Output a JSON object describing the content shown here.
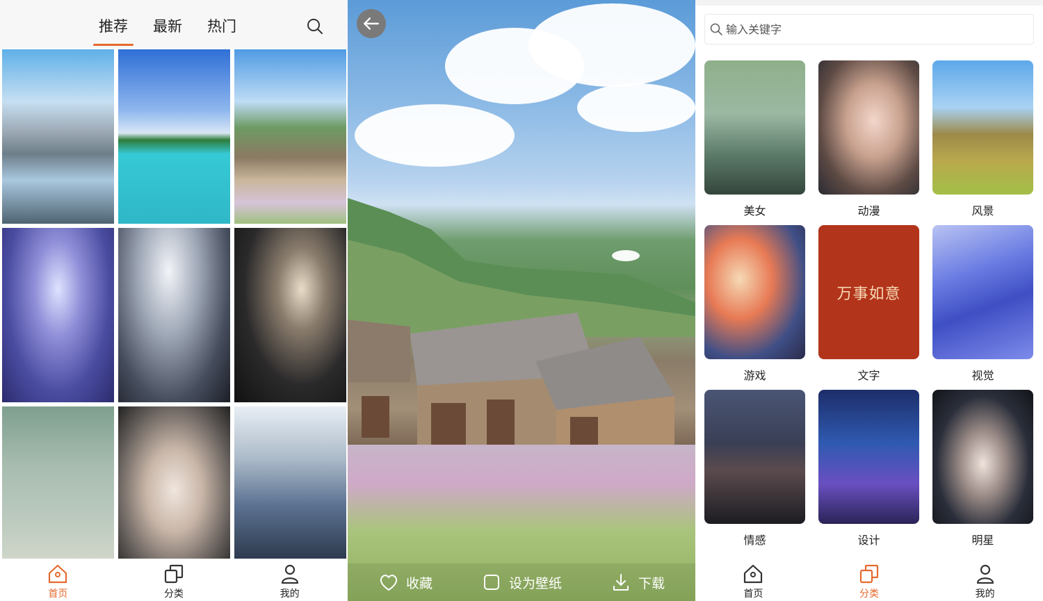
{
  "home": {
    "tabs": [
      "推荐",
      "最新",
      "热门"
    ],
    "active_tab": 0,
    "nav": [
      {
        "label": "首页",
        "icon": "home-icon"
      },
      {
        "label": "分类",
        "icon": "category-icon"
      },
      {
        "label": "我的",
        "icon": "user-icon"
      }
    ],
    "active_nav": 0
  },
  "preview": {
    "actions": [
      {
        "label": "收藏",
        "icon": "heart-icon"
      },
      {
        "label": "设为壁纸",
        "icon": "square-icon"
      },
      {
        "label": "下载",
        "icon": "download-icon"
      }
    ]
  },
  "categories": {
    "search_placeholder": "输入关键字",
    "items": [
      "美女",
      "动漫",
      "风景",
      "游戏",
      "文字",
      "视觉",
      "情感",
      "设计",
      "明星"
    ],
    "text_card": "万事如意",
    "nav": [
      {
        "label": "首页",
        "icon": "home-icon"
      },
      {
        "label": "分类",
        "icon": "category-icon"
      },
      {
        "label": "我的",
        "icon": "user-icon"
      }
    ],
    "active_nav": 1
  },
  "colors": {
    "accent": "#e46a2e",
    "text": "#222222",
    "panel_bg": "#ffffff"
  }
}
